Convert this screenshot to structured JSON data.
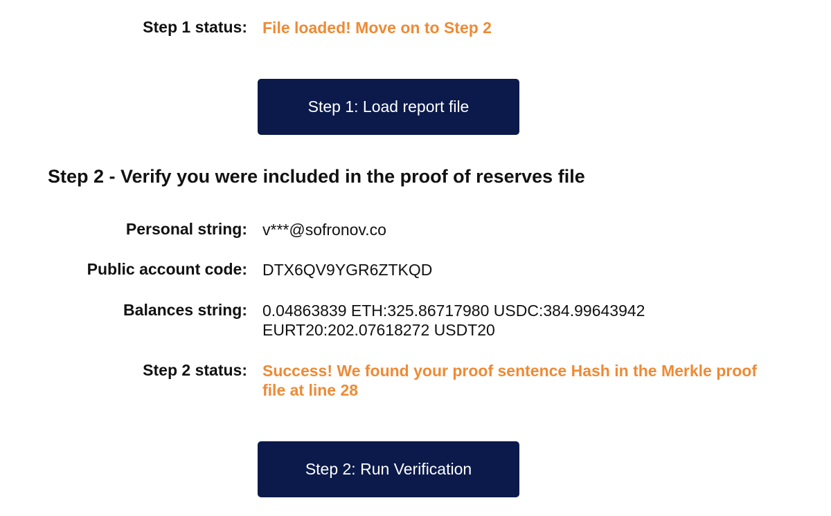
{
  "step1": {
    "status_label": "Step 1 status:",
    "status_value": "File loaded! Move on to Step 2",
    "button_label": "Step 1: Load report file"
  },
  "step2": {
    "heading": "Step 2 - Verify you were included in the proof of reserves file",
    "personal_string_label": "Personal string:",
    "personal_string_value": "v***@sofronov.co",
    "public_account_code_label": "Public account code:",
    "public_account_code_value": "DTX6QV9YGR6ZTKQD",
    "balances_string_label": "Balances string:",
    "balances_string_line1": "0.04863839 ETH:325.86717980 USDC:384.99643942",
    "balances_string_line2": "EURT20:202.07618272 USDT20",
    "status_label": "Step 2 status:",
    "status_line1": "Success! We found your proof sentence Hash in the Merkle proof",
    "status_line2": "file at line 28",
    "button_label": "Step 2: Run Verification"
  },
  "colors": {
    "status_orange": "#ee8a35",
    "button_navy": "#0b1a4a",
    "text": "#111111"
  }
}
